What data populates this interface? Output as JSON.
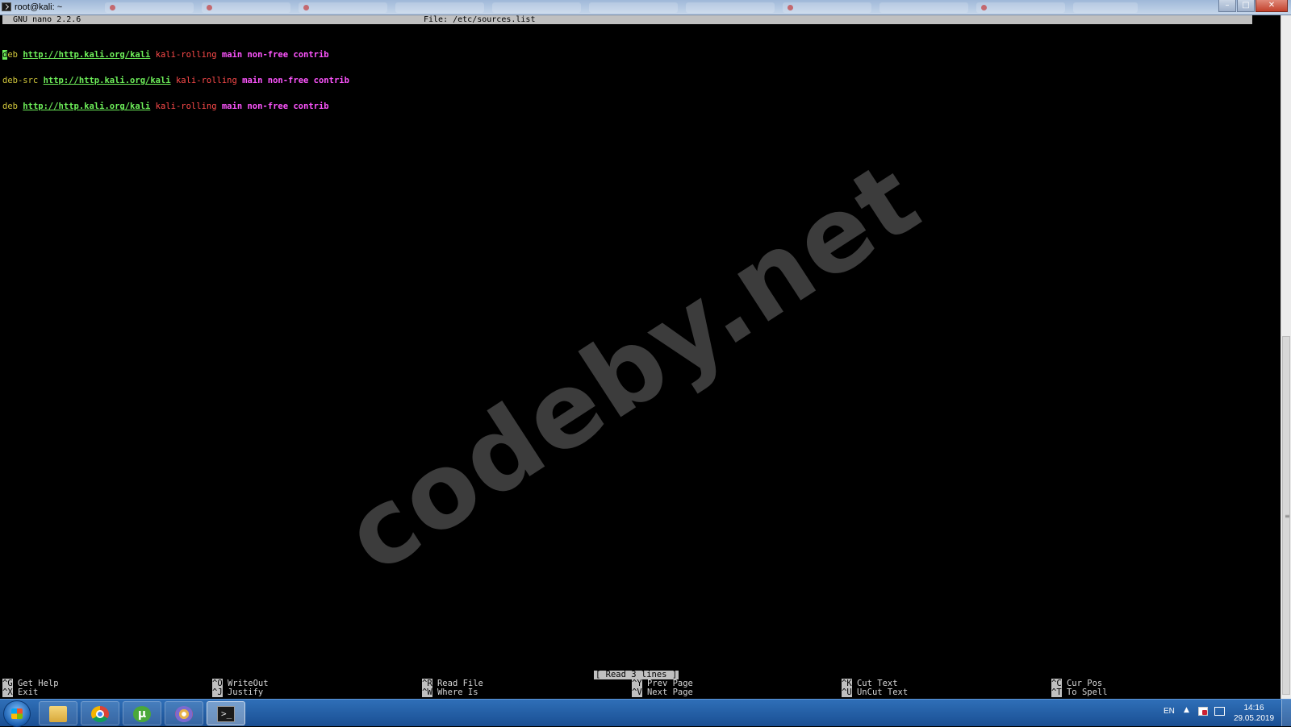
{
  "window": {
    "title": "root@kali: ~",
    "buttons": {
      "minimize": "–",
      "maximize": "□",
      "close": "✕"
    }
  },
  "nano": {
    "version": "GNU nano 2.2.6",
    "file_label": "File: /etc/sources.list",
    "lines": [
      {
        "kw_first": "d",
        "kw_rest": "eb",
        "url": "http://http.kali.org/kali",
        "suite": "kali-rolling",
        "components": "main non-free contrib"
      },
      {
        "kw": "deb-src",
        "url": "http://http.kali.org/kali",
        "suite": "kali-rolling",
        "components": "main non-free contrib"
      },
      {
        "kw": "deb",
        "url": "http://http.kali.org/kali",
        "suite": "kali-rolling",
        "components": "main non-free contrib"
      }
    ],
    "status": "[ Read 3 lines ]",
    "shortcuts": [
      {
        "key": "^G",
        "label": "Get Help"
      },
      {
        "key": "^X",
        "label": "Exit"
      },
      {
        "key": "^O",
        "label": "WriteOut"
      },
      {
        "key": "^J",
        "label": "Justify"
      },
      {
        "key": "^R",
        "label": "Read File"
      },
      {
        "key": "^W",
        "label": "Where Is"
      },
      {
        "key": "^Y",
        "label": "Prev Page"
      },
      {
        "key": "^V",
        "label": "Next Page"
      },
      {
        "key": "^K",
        "label": "Cut Text"
      },
      {
        "key": "^U",
        "label": "UnCut Text"
      },
      {
        "key": "^C",
        "label": "Cur Pos"
      },
      {
        "key": "^T",
        "label": "To Spell"
      }
    ]
  },
  "watermark": "codeby.net",
  "taskbar": {
    "items": [
      {
        "name": "file-explorer-icon"
      },
      {
        "name": "chrome-icon"
      },
      {
        "name": "utorrent-icon",
        "glyph": "µ"
      },
      {
        "name": "media-player-icon"
      },
      {
        "name": "terminal-icon",
        "glyph": ">_"
      }
    ],
    "tray": {
      "language": "EN",
      "time": "14:16",
      "date": "29.05.2019"
    }
  }
}
